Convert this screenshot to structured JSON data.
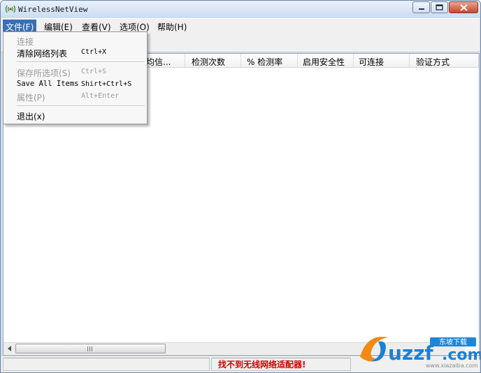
{
  "window": {
    "title": "WirelessNetView"
  },
  "menubar": {
    "items": [
      {
        "label": "文件(F)"
      },
      {
        "label": "编辑(E)"
      },
      {
        "label": "查看(V)"
      },
      {
        "label": "选项(O)"
      },
      {
        "label": "帮助(H)"
      }
    ]
  },
  "file_menu": {
    "connect": {
      "label": "连接"
    },
    "clear_list": {
      "label": "清除网络列表",
      "shortcut": "Ctrl+X"
    },
    "save_selected": {
      "label": "保存所选项(S)",
      "shortcut": "Ctrl+S"
    },
    "save_all": {
      "label": "Save All Items",
      "shortcut": "Shirt+Ctrl+S"
    },
    "properties": {
      "label": "属性(P)",
      "shortcut": "Alt+Enter"
    },
    "exit": {
      "label": "退出(x)"
    }
  },
  "columns": [
    {
      "label": "均信..."
    },
    {
      "label": "检测次数"
    },
    {
      "label": "% 检测率"
    },
    {
      "label": "启用安全性"
    },
    {
      "label": "可连接"
    },
    {
      "label": "验证方式"
    }
  ],
  "statusbar": {
    "message": "找不到无线网络适配器!"
  },
  "watermark": {
    "brand": "uzzf.com",
    "tag": "东坡下载",
    "url": "www.uzzf.com"
  },
  "colors": {
    "menu_highlight": "#3a6fb3",
    "status_error": "#d40000",
    "close_button": "#c4472d"
  }
}
